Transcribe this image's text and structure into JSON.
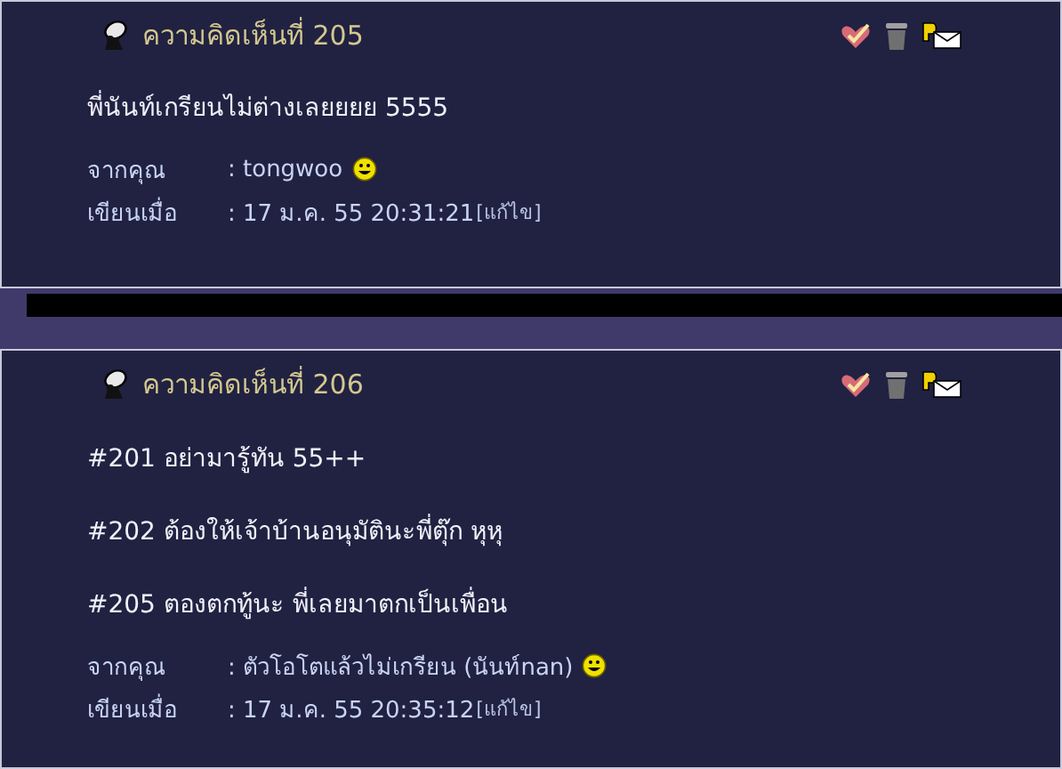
{
  "comments": [
    {
      "title": "ความคิดเห็นที่ 205",
      "paragraphs": [
        "พี่นันท์เกรียนไม่ต่างเลยยยย 5555"
      ],
      "from_label": "จากคุณ",
      "from_value": ": tongwoo",
      "date_label": "เขียนเมื่อ",
      "date_value": ": 17 ม.ค. 55 20:31:21",
      "edit_link": "[แก้ไข]"
    },
    {
      "title": "ความคิดเห็นที่ 206",
      "paragraphs": [
        "#201 อย่ามารู้ทัน 55++",
        "#202 ต้องให้เจ้าบ้านอนุมัตินะพี่ตุ๊ก หุหุ",
        "#205 ตองตกทู้นะ พี่เลยมาตกเป็นเพื่อน"
      ],
      "from_label": "จากคุณ",
      "from_value": ": ตัวโอโตแล้วไม่เกรียน (นันท์nan)",
      "date_label": "เขียนเมื่อ",
      "date_value": ": 17 ม.ค. 55 20:35:12",
      "edit_link": "[แก้ไข]"
    }
  ]
}
